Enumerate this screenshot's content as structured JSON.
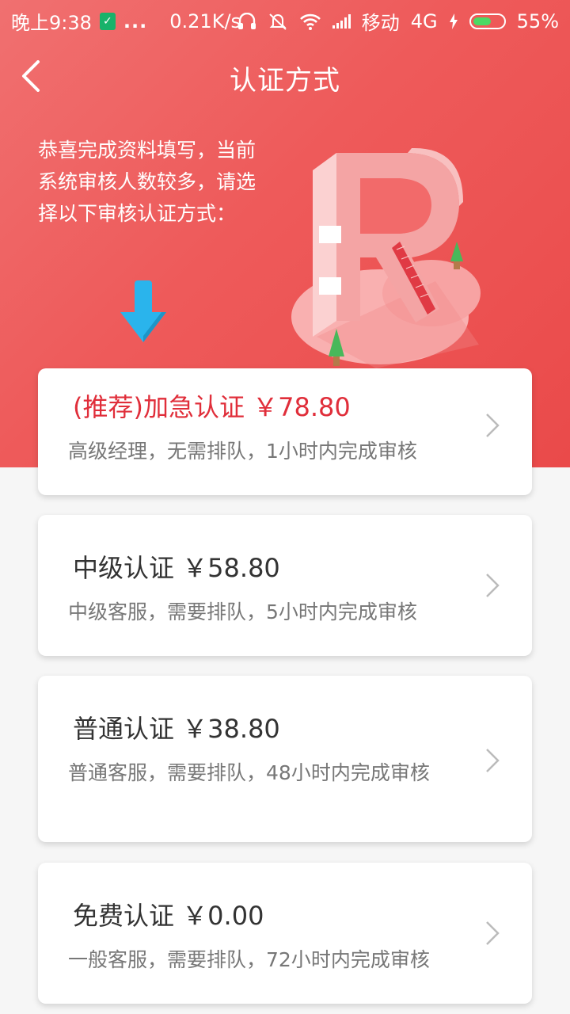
{
  "status_bar": {
    "time": "晚上9:38",
    "more": "...",
    "speed": "0.21K/s",
    "carrier": "移动",
    "network": "4G",
    "battery": "55%"
  },
  "header": {
    "title": "认证方式"
  },
  "intro": {
    "text": "恭喜完成资料填写，当前系统审核人数较多，请选择以下审核认证方式："
  },
  "options": [
    {
      "title": "(推荐)加急认证 ￥78.80",
      "desc": "高级经理，无需排队，1小时内完成审核"
    },
    {
      "title": "中级认证 ￥58.80",
      "desc": "中级客服，需要排队，5小时内完成审核"
    },
    {
      "title": "普通认证 ￥38.80",
      "desc": "普通客服，需要排队，48小时内完成审核"
    },
    {
      "title": "免费认证 ￥0.00",
      "desc": "一般客服，需要排队，72小时内完成审核"
    }
  ],
  "colors": {
    "accent": "#ee5a5a",
    "recommended_text": "#e02e3a",
    "arrow": "#2ab4ec"
  }
}
